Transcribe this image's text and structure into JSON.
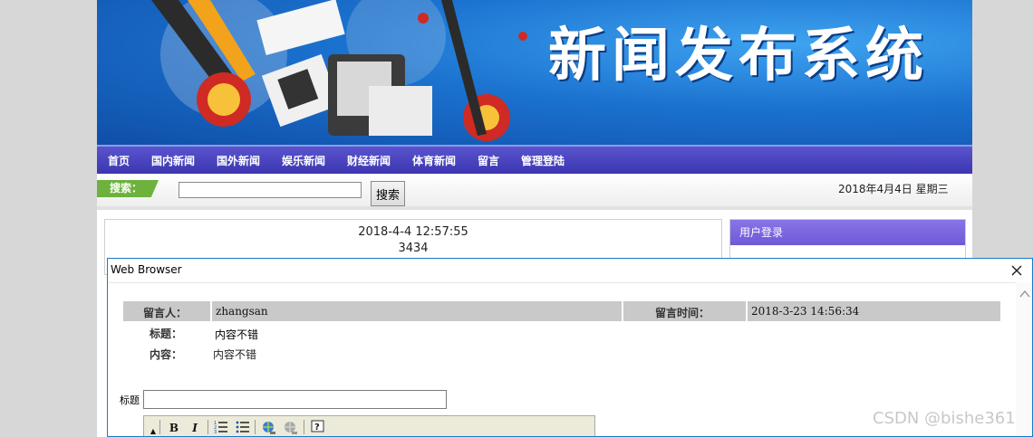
{
  "banner": {
    "title": "新闻发布系统"
  },
  "nav": {
    "items": [
      "首页",
      "国内新闻",
      "国外新闻",
      "娱乐新闻",
      "财经新闻",
      "体育新闻",
      "留言",
      "管理登陆"
    ]
  },
  "search": {
    "label": "搜索：",
    "value": "",
    "button": "搜索",
    "date": "2018年4月4日 星期三"
  },
  "content": {
    "time": "2018-4-4 12:57:55",
    "id": "3434"
  },
  "login": {
    "title": "用户登录"
  },
  "dialog": {
    "title": "Web Browser",
    "message": {
      "author_label": "留言人：",
      "author": "zhangsan",
      "time_label": "留言时间：",
      "time": "2018-3-23 14:56:34",
      "subject_label": "标题：",
      "subject": "内容不错",
      "body_label": "内容：",
      "body": "内容不错"
    },
    "form": {
      "title_label": "标题",
      "title_value": ""
    }
  },
  "watermark": "CSDN @bishe361",
  "colors": {
    "nav": "#3b35b1",
    "dialog_border": "#1979ca",
    "search_tag": "#6cb23c"
  }
}
